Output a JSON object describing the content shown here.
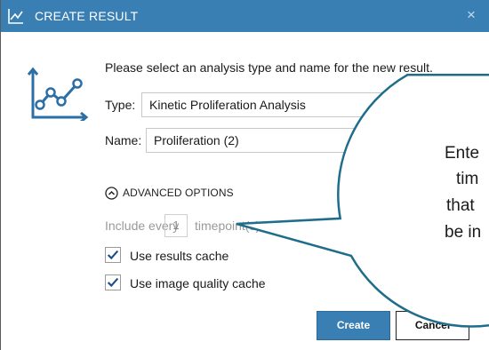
{
  "dialog": {
    "title": "CREATE RESULT",
    "close_glyph": "×",
    "prompt": "Please select an analysis type and name for the new result.",
    "type_label": "Type:",
    "type_value": "Kinetic Proliferation Analysis",
    "name_label": "Name:",
    "name_value": "Proliferation (2)",
    "advanced_label": "ADVANCED OPTIONS",
    "include_prefix": "Include every",
    "include_value": "1",
    "include_suffix": "timepoint(s).",
    "checkboxes": [
      {
        "label": "Use results cache",
        "checked": true
      },
      {
        "label": "Use image quality cache",
        "checked": true
      }
    ],
    "create_label": "Create",
    "cancel_label": "Cancel"
  },
  "callout": {
    "lines": [
      "Ente",
      "tim",
      "that",
      "be in"
    ]
  },
  "colors": {
    "titlebar": "#3a7fb4",
    "accent": "#3a7fb4",
    "callout_border": "#1f6d8a",
    "check": "#1a4e8a"
  },
  "icons": {
    "title": "line-chart-icon",
    "dialog": "line-chart-icon",
    "close": "close-icon",
    "advanced": "chevron-up-circle-icon",
    "checkbox": "checkmark-icon"
  }
}
